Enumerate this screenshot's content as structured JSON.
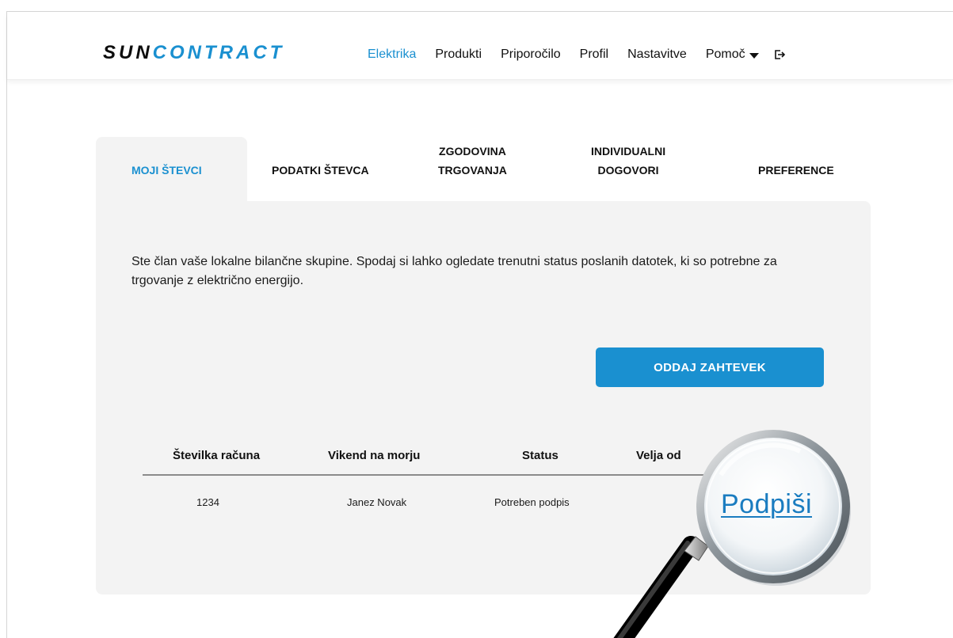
{
  "brand": {
    "part1": "SUN",
    "part2": "CONTRACT"
  },
  "nav": {
    "items": [
      "Elektrika",
      "Produkti",
      "Priporočilo",
      "Profil",
      "Nastavitve"
    ],
    "help_label": "Pomoč",
    "active": "Elektrika",
    "help_icon": "caret-down-icon",
    "logout_icon": "logout-icon"
  },
  "tabs": [
    {
      "line1": "MOJI ŠTEVCI",
      "line2": ""
    },
    {
      "line1": "PODATKI ŠTEVCA",
      "line2": ""
    },
    {
      "line1": "ZGODOVINA",
      "line2": "TRGOVANJA"
    },
    {
      "line1": "INDIVIDUALNI",
      "line2": "DOGOVORI"
    },
    {
      "line1": "PREFERENCE",
      "line2": ""
    }
  ],
  "intro_text": "Ste član vaše lokalne bilančne skupine. Spodaj si lahko ogledate trenutni status poslanih datotek, ki so potrebne za trgovanje z električno energijo.",
  "cta_label": "ODDAJ ZAHTEVEK",
  "table": {
    "headers": [
      "Številka računa",
      "Vikend na morju",
      "Status",
      "Velja od"
    ],
    "rows": [
      {
        "account": "1234",
        "name": "Janez Novak",
        "status": "Potreben podpis"
      }
    ]
  },
  "sign_link": "Podpiši",
  "colors": {
    "accent": "#1a90d0",
    "panel": "#f3f3f3",
    "link": "#1a7cc0"
  }
}
